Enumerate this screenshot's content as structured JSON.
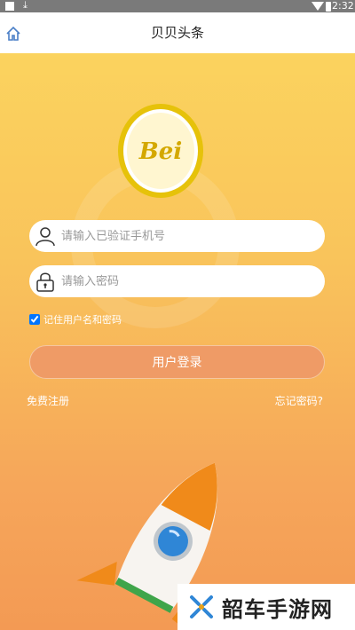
{
  "status_bar": {
    "time": "2:32",
    "download_glyph": "⤓"
  },
  "nav": {
    "title": "贝贝头条",
    "home_icon": "home-icon"
  },
  "logo": {
    "text": "Bei"
  },
  "phone_field": {
    "placeholder": "请输入已验证手机号",
    "value": ""
  },
  "password_field": {
    "placeholder": "请输入密码",
    "value": ""
  },
  "remember": {
    "label": "记住用户名和密码",
    "checked": true
  },
  "login_button": {
    "label": "用户登录"
  },
  "links": {
    "register": "免费注册",
    "forgot": "忘记密码?"
  },
  "watermark": {
    "text": "韶车手游网"
  },
  "colors": {
    "accent": "#ef9b66",
    "logo_ring": "#e6c20a",
    "nav_bg": "#ffffff"
  }
}
